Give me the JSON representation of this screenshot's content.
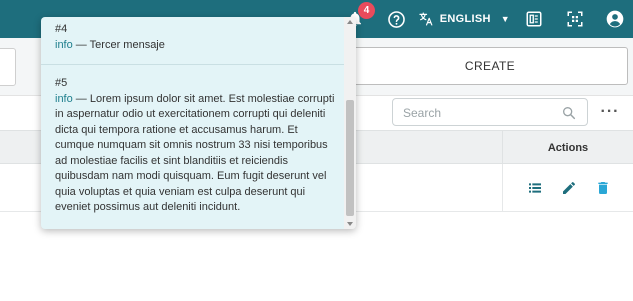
{
  "topbar": {
    "notification_count": "4",
    "language_label": "ENGLISH",
    "colors": {
      "bar": "#1e6e7d",
      "badge": "#e94b5c"
    }
  },
  "toolbar": {
    "create_label": "CREATE"
  },
  "search": {
    "placeholder": "Search"
  },
  "table": {
    "actions_header": "Actions",
    "row_action_colors": {
      "list": "#1e6e7d",
      "edit": "#1e6e7d",
      "delete": "#2aa7d6"
    }
  },
  "notifications": {
    "items": [
      {
        "number": "#4",
        "level": "info",
        "separator": " — ",
        "message": "Tercer mensaje"
      },
      {
        "number": "#5",
        "level": "info",
        "separator": " — ",
        "message": "Lorem ipsum dolor sit amet. Est molestiae corrupti in aspernatur odio ut exercitationem corrupti qui deleniti dicta qui tempora ratione et accusamus harum. Et cumque numquam sit omnis nostrum 33 nisi temporibus ad molestiae facilis et sint blanditiis et reiciendis quibusdam nam modi quisquam. Eum fugit deserunt vel quia voluptas et quia veniam est culpa deserunt qui eveniet possimus aut deleniti incidunt."
      }
    ]
  }
}
